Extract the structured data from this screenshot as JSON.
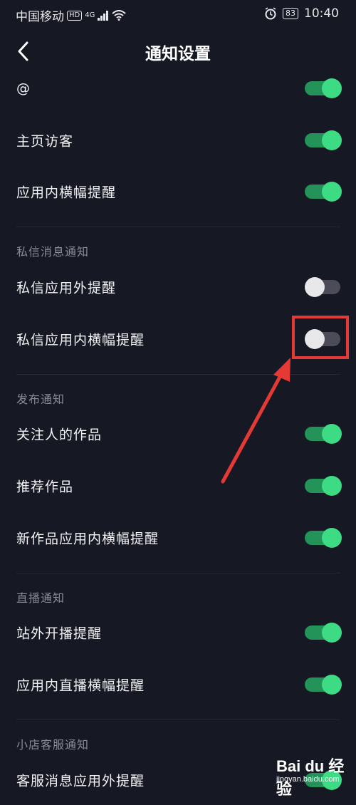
{
  "status_bar": {
    "carrier": "中国移动",
    "hd_badge": "HD",
    "network": "4G",
    "battery": "83",
    "time": "10:40"
  },
  "header": {
    "title": "通知设置"
  },
  "rows": [
    {
      "label": "@",
      "enabled": true
    },
    {
      "label": "主页访客",
      "enabled": true
    },
    {
      "label": "应用内横幅提醒",
      "enabled": true
    },
    {
      "label": "私信应用外提醒",
      "enabled": false
    },
    {
      "label": "私信应用内横幅提醒",
      "enabled": false
    },
    {
      "label": "关注人的作品",
      "enabled": true
    },
    {
      "label": "推荐作品",
      "enabled": true
    },
    {
      "label": "新作品应用内横幅提醒",
      "enabled": true
    },
    {
      "label": "站外开播提醒",
      "enabled": true
    },
    {
      "label": "应用内直播横幅提醒",
      "enabled": true
    },
    {
      "label": "客服消息应用外提醒",
      "enabled": true
    }
  ],
  "sections": {
    "private_message": "私信消息通知",
    "publish": "发布通知",
    "live": "直播通知",
    "shop_service": "小店客服通知"
  },
  "colors": {
    "background": "#161823",
    "toggle_on": "#3ddc84",
    "toggle_off": "#e8e8ea",
    "annotation": "#e53935"
  },
  "watermark": {
    "brand": "Bai du 经验",
    "site": "jingyan.baidu.com"
  }
}
